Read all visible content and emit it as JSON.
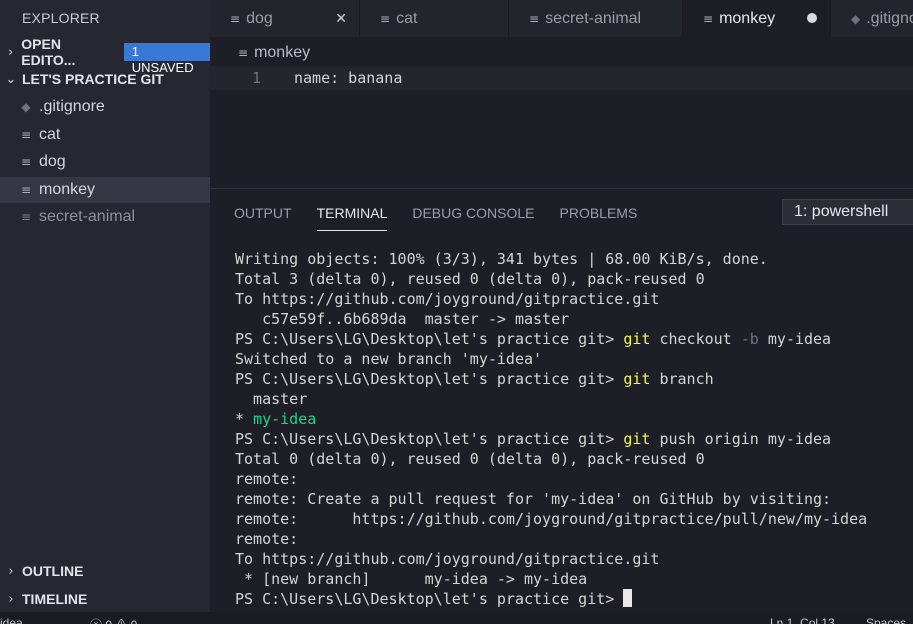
{
  "sidebar": {
    "title": "EXPLORER",
    "open_editors": {
      "label": "OPEN EDITO...",
      "badge": "1 UNSAVED",
      "chevron": "chevron-right-icon"
    },
    "project": {
      "label": "LET'S PRACTICE GIT",
      "chevron": "chevron-down-icon"
    },
    "files": [
      {
        "name": ".gitignore",
        "icon": "git-icon"
      },
      {
        "name": "cat",
        "icon": "file-lines-icon"
      },
      {
        "name": "dog",
        "icon": "file-lines-icon"
      },
      {
        "name": "monkey",
        "icon": "file-lines-icon",
        "active": true
      },
      {
        "name": "secret-animal",
        "icon": "file-lines-icon",
        "dim": true
      }
    ],
    "outline": "OUTLINE",
    "timeline": "TIMELINE"
  },
  "tabs": [
    {
      "label": "dog"
    },
    {
      "label": "cat"
    },
    {
      "label": "secret-animal"
    },
    {
      "label": "monkey",
      "active": true,
      "unsaved": true
    },
    {
      "label": ".gitignore"
    }
  ],
  "editor": {
    "breadcrumb": "monkey",
    "line_number": "1",
    "line_text": "name: banana"
  },
  "panel": {
    "tabs": [
      "OUTPUT",
      "TERMINAL",
      "DEBUG CONSOLE",
      "PROBLEMS"
    ],
    "active_tab": "TERMINAL",
    "terminal_select": "1: powershell",
    "terminal": {
      "prompt": "PS C:\\Users\\LG\\Desktop\\let's practice git> ",
      "l1": "Writing objects: 100% (3/3), 341 bytes | 68.00 KiB/s, done.",
      "l2": "Total 3 (delta 0), reused 0 (delta 0), pack-reused 0",
      "l3": "To https://github.com/joyground/gitpractice.git",
      "l4": "   c57e59f..6b689da  master -> master",
      "l5_cmd": "git",
      "l5_args": " checkout ",
      "l5_flag": "-b",
      "l5_rest": " my-idea",
      "l6": "Switched to a new branch 'my-idea'",
      "l7_cmd": "git",
      "l7_rest": " branch",
      "l8": "  master",
      "l9_star": "* ",
      "l9_branch": "my-idea",
      "l10_cmd": "git",
      "l10_rest": " push origin my-idea",
      "l11": "Total 0 (delta 0), reused 0 (delta 0), pack-reused 0",
      "l12": "remote:",
      "l13": "remote: Create a pull request for 'my-idea' on GitHub by visiting:",
      "l14": "remote:      https://github.com/joyground/gitpractice/pull/new/my-idea",
      "l15": "remote:",
      "l16": "To https://github.com/joyground/gitpractice.git",
      "l17": " * [new branch]      my-idea -> my-idea"
    }
  },
  "statusbar": {
    "branch": "idea",
    "problems": "ⓧ 0 ⚠ 0",
    "position": "Ln 1, Col 13",
    "spaces": "Spaces"
  }
}
